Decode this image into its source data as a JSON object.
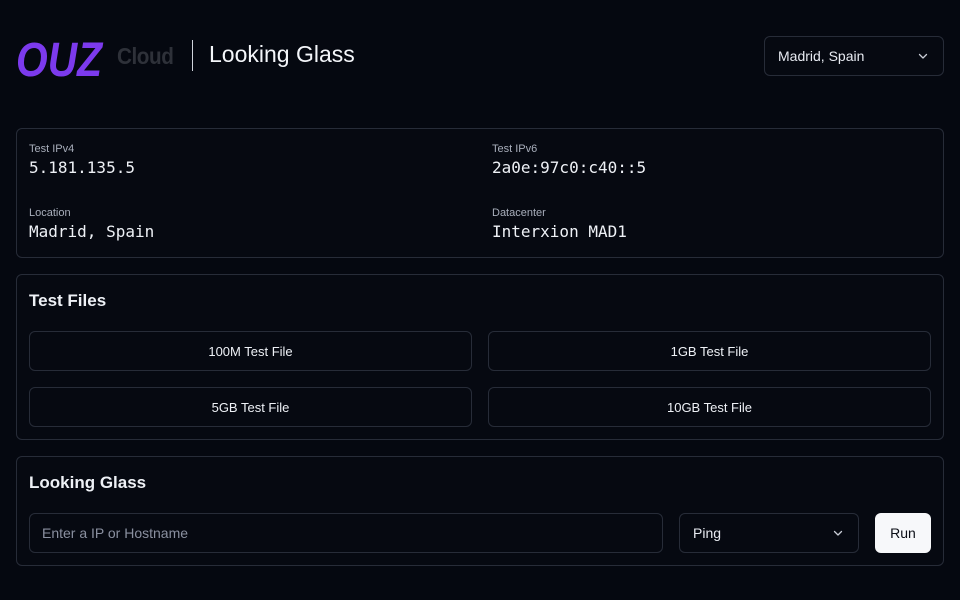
{
  "header": {
    "logo_text": "OUZ",
    "logo_sub": "Cloud",
    "title": "Looking Glass",
    "region_select": {
      "value": "Madrid, Spain",
      "icon": "chevron-down-icon"
    }
  },
  "info": {
    "ipv4": {
      "label": "Test IPv4",
      "value": "5.181.135.5"
    },
    "ipv6": {
      "label": "Test IPv6",
      "value": "2a0e:97c0:c40::5"
    },
    "location": {
      "label": "Location",
      "value": "Madrid, Spain"
    },
    "datacenter": {
      "label": "Datacenter",
      "value": "Interxion MAD1"
    }
  },
  "test_files": {
    "title": "Test Files",
    "buttons": [
      "100M Test File",
      "1GB Test File",
      "5GB Test File",
      "10GB Test File"
    ]
  },
  "looking_glass": {
    "title": "Looking Glass",
    "input_placeholder": "Enter a IP or Hostname",
    "input_value": "",
    "method_select": {
      "value": "Ping",
      "icon": "chevron-down-icon"
    },
    "run_label": "Run"
  },
  "colors": {
    "background": "#050810",
    "border": "#272c38",
    "logo_purple": "#7c3aed",
    "button_light": "#f7f8fa"
  }
}
